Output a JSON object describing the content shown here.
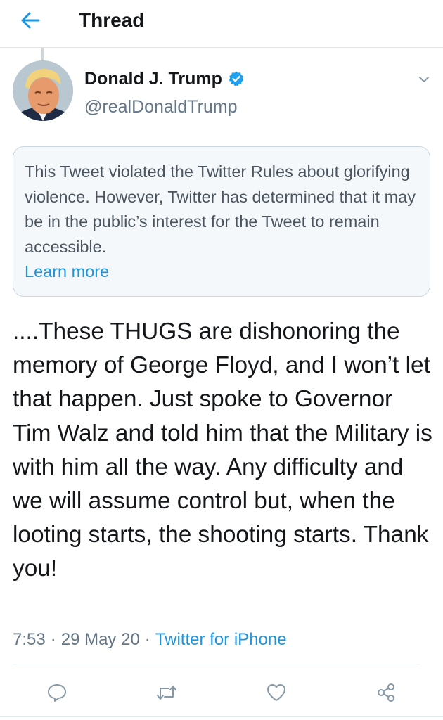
{
  "header": {
    "title": "Thread",
    "back_icon": "arrow-left-icon"
  },
  "tweet": {
    "author": {
      "name": "Donald J. Trump",
      "handle": "@realDonaldTrump",
      "verified": true
    },
    "notice": {
      "text": "This Tweet violated the Twitter Rules about glorifying violence. However, Twitter has determined that it may be in the public’s interest for the Tweet to remain accessible.",
      "link_label": "Learn more"
    },
    "body": "....These THUGS are dishonoring the memory of George Floyd, and I won’t let that happen. Just spoke to Governor Tim Walz and told him that the Military is with him all the way. Any difficulty and we will assume control but, when the looting starts, the shooting starts. Thank you!",
    "time": "7:53",
    "date": "29 May 20",
    "separator": "·",
    "source": "Twitter for iPhone"
  },
  "actions": {
    "reply_icon": "reply-icon",
    "retweet_icon": "retweet-icon",
    "like_icon": "heart-icon",
    "share_icon": "share-icon"
  },
  "colors": {
    "accent": "#1b95e0",
    "text": "#14171a",
    "secondary": "#657786",
    "notice_bg": "#f5f8fa",
    "border": "#ccd6dd"
  }
}
